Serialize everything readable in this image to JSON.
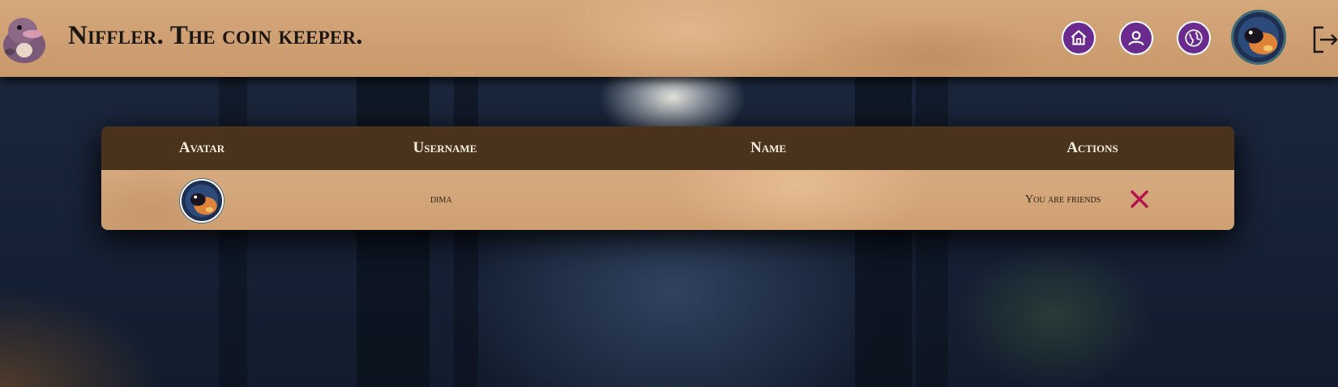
{
  "header": {
    "app_title": "Niffler. The coin keeper.",
    "nav": [
      {
        "icon": "home-icon",
        "label": "Main page"
      },
      {
        "icon": "profile-icon",
        "label": "Profile"
      },
      {
        "icon": "friends-icon",
        "label": "Friends"
      }
    ],
    "logout_icon": "logout-icon"
  },
  "colors": {
    "header_bg": "#c9996b",
    "nav_button": "#6b2a8e",
    "table_head": "#4a331c",
    "table_body": "#d2a478",
    "remove_icon": "#b3124c"
  },
  "table": {
    "columns": [
      "Avatar",
      "Username",
      "Name",
      "Actions"
    ],
    "rows": [
      {
        "username": "dima",
        "name": "",
        "status": "You are friends",
        "action_icon": "close-icon"
      }
    ]
  }
}
